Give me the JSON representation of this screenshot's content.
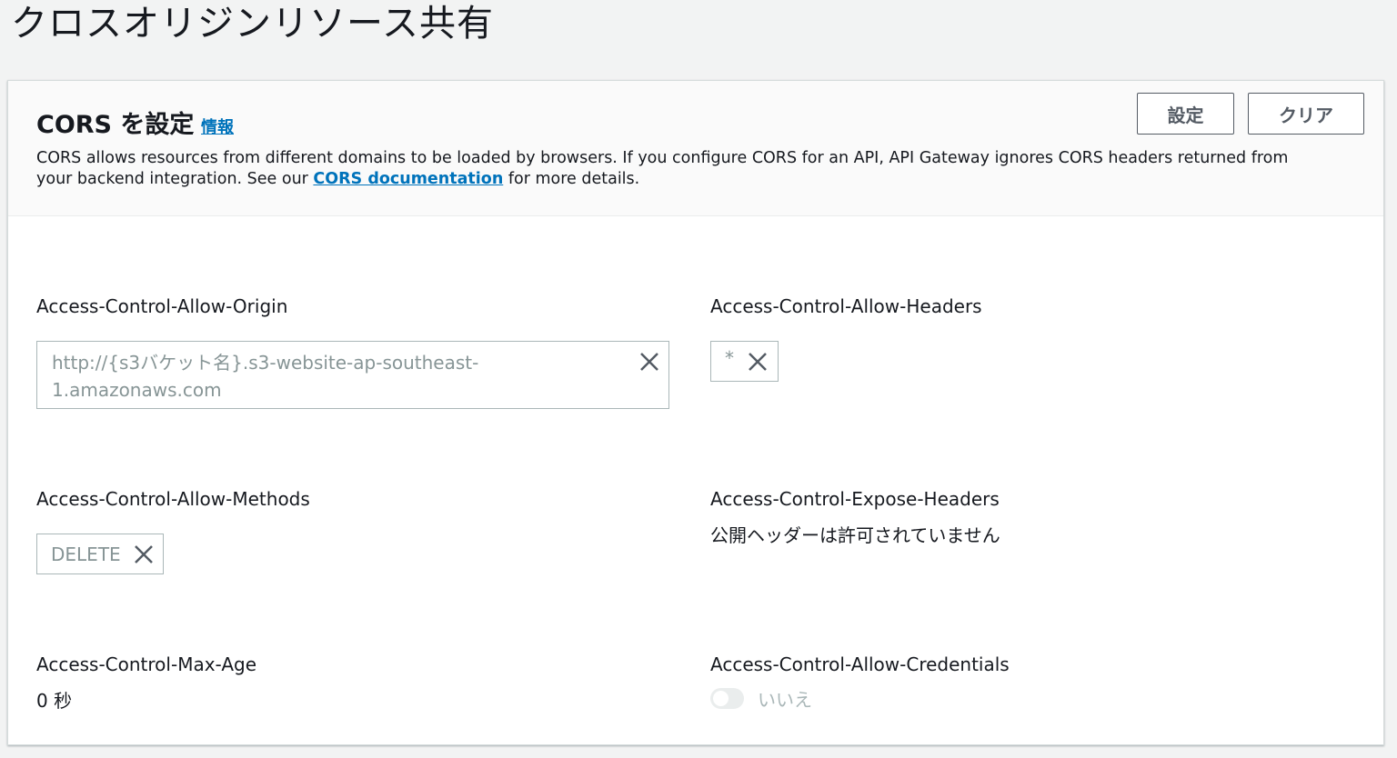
{
  "page": {
    "title": "クロスオリジンリソース共有"
  },
  "panel": {
    "title": "CORS を設定",
    "info_link": "情報",
    "desc_part1": "CORS allows resources from different domains to be loaded by browsers. If you configure CORS for an API, API Gateway ignores CORS headers returned from your backend integration. See our ",
    "desc_link": "CORS documentation",
    "desc_part2": " for more details.",
    "set_button": "設定",
    "clear_button": "クリア"
  },
  "fields": {
    "allow_origin": {
      "label": "Access-Control-Allow-Origin",
      "value_line1": "http://{s3バケット名}.s3-website-ap-southeast-",
      "value_line2": "1.amazonaws.com"
    },
    "allow_headers": {
      "label": "Access-Control-Allow-Headers",
      "value": "*"
    },
    "allow_methods": {
      "label": "Access-Control-Allow-Methods",
      "value": "DELETE"
    },
    "expose_headers": {
      "label": "Access-Control-Expose-Headers",
      "value": "公開ヘッダーは許可されていません"
    },
    "max_age": {
      "label": "Access-Control-Max-Age",
      "value": "0 秒"
    },
    "allow_credentials": {
      "label": "Access-Control-Allow-Credentials",
      "value": "いいえ",
      "enabled": false
    }
  },
  "icons": {
    "remove": "close-icon"
  },
  "colors": {
    "link": "#0073bb",
    "button_text": "#545b64",
    "token_border": "#aab7b8",
    "token_text": "#879596"
  }
}
